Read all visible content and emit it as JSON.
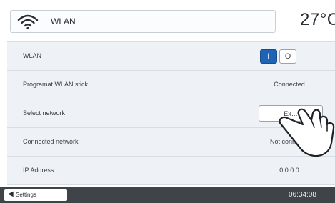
{
  "header": {
    "title": "WLAN",
    "temperature": "27°C",
    "icon": "wifi-icon"
  },
  "settings": [
    {
      "label": "WLAN",
      "control": "toggle",
      "on_label": "I",
      "off_label": "O",
      "state": "on"
    },
    {
      "label": "Programat WLAN stick",
      "value": "Connected"
    },
    {
      "label": "Select network",
      "control": "button",
      "button_label": "Ex…"
    },
    {
      "label": "Connected network",
      "value": "Not connected"
    },
    {
      "label": "IP Address",
      "value": "0.0.0.0"
    }
  ],
  "footer": {
    "back_label": "Settings",
    "clock": "06:34:08"
  },
  "colors": {
    "accent": "#1f63b5",
    "footer_bg": "#3f4449",
    "list_bg": "#eef1f5"
  }
}
